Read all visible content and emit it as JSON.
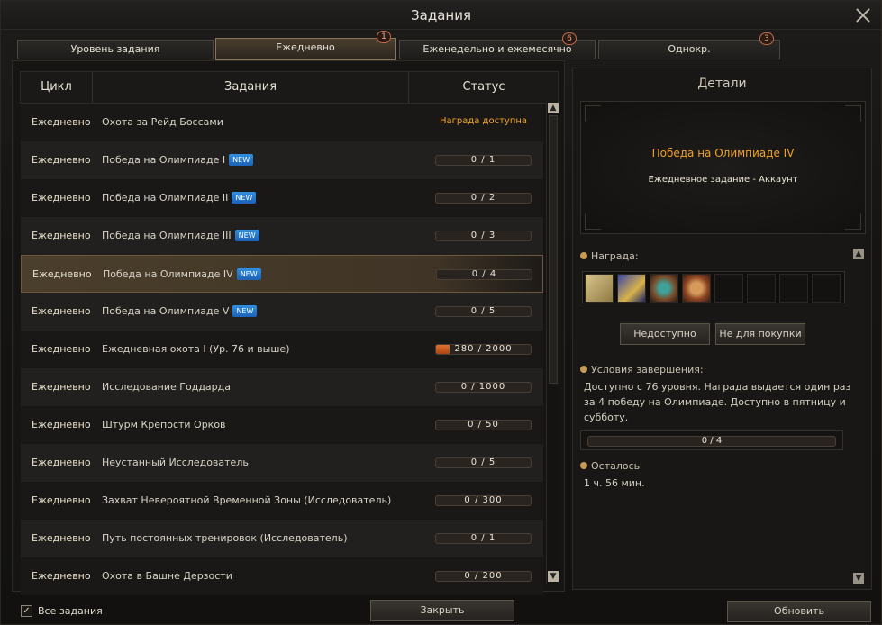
{
  "window": {
    "title": "Задания"
  },
  "tabs": [
    {
      "label": "Уровень задания",
      "badge": ""
    },
    {
      "label": "Ежедневно",
      "badge": "1"
    },
    {
      "label": "Еженедельно и ежемесячно",
      "badge": "6"
    },
    {
      "label": "Однокр.",
      "badge": "3"
    }
  ],
  "table": {
    "columns": [
      "Цикл",
      "Задания",
      "Статус"
    ],
    "rows": [
      {
        "cycle": "Ежедневно",
        "name": "Охота за Рейд Боссами",
        "new": "",
        "status": "Награда доступна",
        "progress": null,
        "fill": 0
      },
      {
        "cycle": "Ежедневно",
        "name": "Победа на Олимпиаде I",
        "new": "NEW",
        "status": "",
        "progress": "0 / 1",
        "fill": 0
      },
      {
        "cycle": "Ежедневно",
        "name": "Победа на Олимпиаде II",
        "new": "NEW",
        "status": "",
        "progress": "0 / 2",
        "fill": 0
      },
      {
        "cycle": "Ежедневно",
        "name": "Победа на Олимпиаде III",
        "new": "NEW",
        "status": "",
        "progress": "0 / 3",
        "fill": 0
      },
      {
        "cycle": "Ежедневно",
        "name": "Победа на Олимпиаде IV",
        "new": "NEW",
        "status": "",
        "progress": "0 / 4",
        "fill": 0,
        "selected": true
      },
      {
        "cycle": "Ежедневно",
        "name": "Победа на Олимпиаде V",
        "new": "NEW",
        "status": "",
        "progress": "0 / 5",
        "fill": 0
      },
      {
        "cycle": "Ежедневно",
        "name": "Ежедневная охота I (Ур. 76 и выше)",
        "new": "",
        "status": "",
        "progress": "280 / 2000",
        "fill": 0.14
      },
      {
        "cycle": "Ежедневно",
        "name": "Исследование Годдарда",
        "new": "",
        "status": "",
        "progress": "0 / 1000",
        "fill": 0
      },
      {
        "cycle": "Ежедневно",
        "name": "Штурм Крепости Орков",
        "new": "",
        "status": "",
        "progress": "0 / 50",
        "fill": 0
      },
      {
        "cycle": "Ежедневно",
        "name": "Неустанный Исследователь",
        "new": "",
        "status": "",
        "progress": "0 / 5",
        "fill": 0
      },
      {
        "cycle": "Ежедневно",
        "name": "Захват Невероятной Временной Зоны (Исследователь)",
        "new": "",
        "status": "",
        "progress": "0 / 300",
        "fill": 0
      },
      {
        "cycle": "Ежедневно",
        "name": "Путь постоянных тренировок (Исследователь)",
        "new": "",
        "status": "",
        "progress": "0 / 1",
        "fill": 0
      },
      {
        "cycle": "Ежедневно",
        "name": "Охота в Башне Дерзости",
        "new": "",
        "status": "",
        "progress": "0 / 200",
        "fill": 0
      }
    ]
  },
  "details": {
    "title": "Детали",
    "quest_name": "Победа на Олимпиаде IV",
    "quest_sub": "Ежедневное задание  -  Аккаунт",
    "reward_label": "Награда:",
    "reward_icons": [
      "scroll-icon",
      "crown-icon",
      "amulet-icon",
      "coin-icon"
    ],
    "btn_unavailable": "Недоступно",
    "btn_not_for_sale": "Не для покупки",
    "conditions_label": "Условия завершения:",
    "conditions_text": "Доступно с 76 уровня. Награда выдается один раз за 4 победу на Олимпиаде. Доступно в пятницу и субботу.",
    "progress": "0 / 4",
    "remaining_label": "Осталось",
    "remaining_value": "1 ч. 56 мин."
  },
  "bottom": {
    "all_quests_label": "Все задания",
    "all_quests_checked": "✓",
    "close_label": "Закрыть",
    "refresh_label": "Обновить"
  },
  "colors": {
    "accent": "#f0a12a",
    "progress_fill": "#e0722f",
    "new_badge": "#1c62b8"
  }
}
